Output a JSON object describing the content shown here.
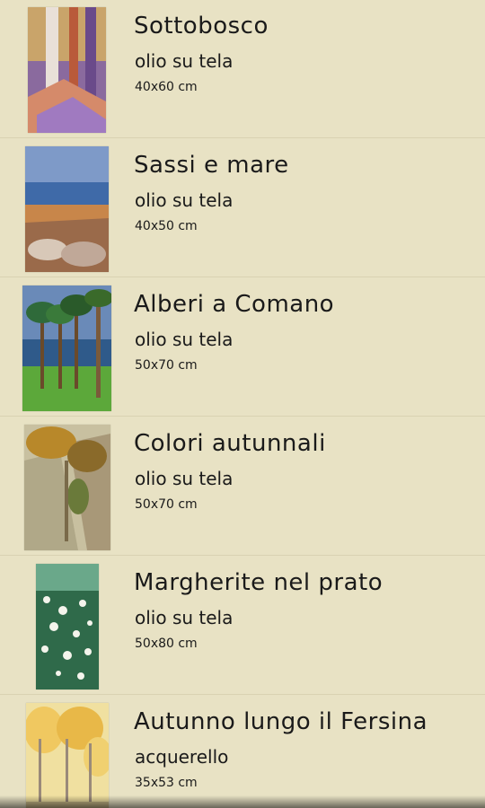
{
  "paintings": [
    {
      "title": "Sottobosco",
      "medium": "olio su tela",
      "size": "40x60 cm"
    },
    {
      "title": "Sassi e mare",
      "medium": "olio su tela",
      "size": "40x50 cm"
    },
    {
      "title": "Alberi a Comano",
      "medium": "olio su tela",
      "size": "50x70 cm"
    },
    {
      "title": "Colori autunnali",
      "medium": "olio su tela",
      "size": "50x70 cm"
    },
    {
      "title": "Margherite nel prato",
      "medium": "olio su tela",
      "size": "50x80 cm"
    },
    {
      "title": "Autunno lungo il Fersina",
      "medium": "acquerello",
      "size": "35x53 cm"
    }
  ]
}
